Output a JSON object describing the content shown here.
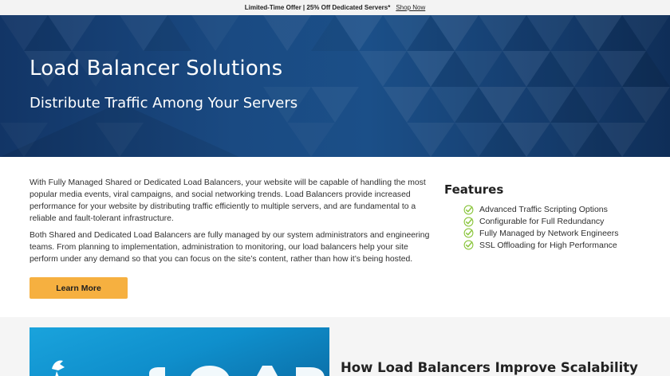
{
  "promo": {
    "text": "Limited-Time Offer | 25% Off Dedicated Servers*",
    "link": "Shop Now"
  },
  "hero": {
    "title": "Load Balancer Solutions",
    "subtitle": "Distribute Traffic Among Your Servers"
  },
  "intro": {
    "paragraph_1": "With Fully Managed Shared or Dedicated Load Balancers, your website will be capable of handling the most popular media events, viral campaigns, and social networking trends. Load Balancers provide increased performance for your website by distributing traffic efficiently to multiple servers, and are fundamental to a reliable and fault-tolerant infrastructure.",
    "paragraph_2": "Both Shared and Dedicated Load Balancers are fully managed by our system administrators and engineering teams. From planning to implementation, administration to monitoring, our load balancers help your site perform under any demand so that you can focus on the site’s content, rather than how it’s being hosted.",
    "cta_label": "Learn More"
  },
  "features": {
    "title": "Features",
    "items": [
      "Advanced Traffic Scripting Options",
      "Configurable for Full Redundancy",
      "Fully Managed by Network Engineers",
      "SSL Offloading for High Performance"
    ],
    "check_color": "#8cc63f"
  },
  "scalability": {
    "heading": "How Load Balancers Improve Scalability"
  },
  "colors": {
    "cta": "#f6b040",
    "hero_dark": "#123566",
    "promo_bg": "#f3f3f3",
    "lower_bg": "#f5f5f5"
  }
}
